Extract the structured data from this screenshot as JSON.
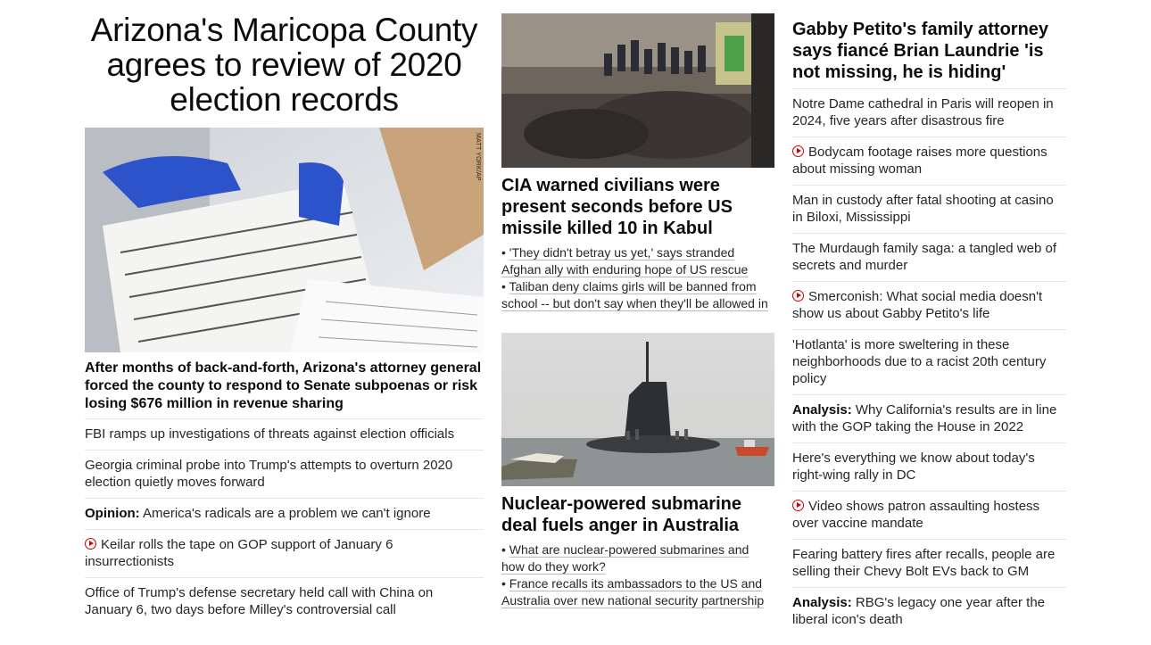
{
  "col1": {
    "hero_title": "Arizona's Maricopa County agrees to review of 2020 election records",
    "photo_credit": "MATT YORK/AP",
    "lead": "After months of back-and-forth, Arizona's attorney general forced the county to respond to Senate subpoenas or risk losing $676 million in revenue sharing",
    "items": [
      {
        "label": "",
        "text": "FBI ramps up investigations of threats against election officials",
        "video": false
      },
      {
        "label": "",
        "text": "Georgia criminal probe into Trump's attempts to overturn 2020 election quietly moves forward",
        "video": false
      },
      {
        "label": "Opinion:",
        "text": "America's radicals are a problem we can't ignore",
        "video": false
      },
      {
        "label": "",
        "text": "Keilar rolls the tape on GOP support of January 6 insurrectionists",
        "video": true
      },
      {
        "label": "",
        "text": "Office of Trump's defense secretary held call with China on January 6, two days before Milley's controversial call",
        "video": false
      }
    ]
  },
  "col2": {
    "story1": {
      "headline": "CIA warned civilians were present seconds before US missile killed 10 in Kabul",
      "bullets": [
        "'They didn't betray us yet,' says stranded Afghan ally with enduring hope of US rescue",
        "Taliban deny claims girls will be banned from school -- but don't say when they'll be allowed in"
      ]
    },
    "story2": {
      "headline": "Nuclear-powered submarine deal fuels anger in Australia",
      "bullets": [
        "What are nuclear-powered submarines and how do they work?",
        "France recalls its ambassadors to the US and Australia over new national security partnership"
      ]
    },
    "bullet_char": "•"
  },
  "col3": {
    "headline": "Gabby Petito's family attorney says fiancé Brian Laundrie 'is not missing, he is hiding'",
    "items": [
      {
        "label": "",
        "text": "Notre Dame cathedral in Paris will reopen in 2024, five years after disastrous fire",
        "video": false
      },
      {
        "label": "",
        "text": "Bodycam footage raises more questions about missing woman",
        "video": true
      },
      {
        "label": "",
        "text": "Man in custody after fatal shooting at casino in Biloxi, Mississippi",
        "video": false
      },
      {
        "label": "",
        "text": "The Murdaugh family saga: a tangled web of secrets and murder",
        "video": false
      },
      {
        "label": "",
        "text": "Smerconish: What social media doesn't show us about Gabby Petito's life",
        "video": true
      },
      {
        "label": "",
        "text": "'Hotlanta' is more sweltering in these neighborhoods due to a racist 20th century policy",
        "video": false
      },
      {
        "label": "Analysis:",
        "text": "Why California's results are in line with the GOP taking the House in 2022",
        "video": false
      },
      {
        "label": "",
        "text": "Here's everything we know about today's right-wing rally in DC",
        "video": false
      },
      {
        "label": "",
        "text": "Video shows patron assaulting hostess over vaccine mandate",
        "video": true
      },
      {
        "label": "",
        "text": "Fearing battery fires after recalls, people are selling their Chevy Bolt EVs back to GM",
        "video": false
      },
      {
        "label": "Analysis:",
        "text": "RBG's legacy one year after the liberal icon's death",
        "video": false
      }
    ]
  },
  "colors": {
    "video_icon": "#cc0000",
    "divider": "#e6e6e6",
    "text": "#262626"
  }
}
